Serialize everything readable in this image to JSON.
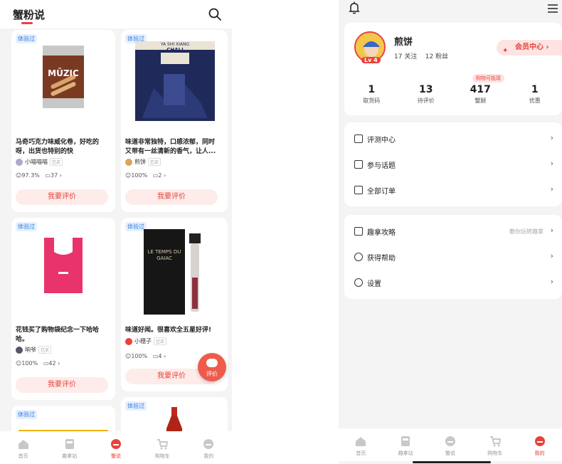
{
  "left": {
    "header": {
      "title": "蟹粉说"
    },
    "cards": [
      {
        "tag": "体验过",
        "brand": "MŪZIC",
        "title": "马奇巧克力味威化卷，好吃的呀，出货也特别的快",
        "user": "小喵喵喵",
        "user_chip": "已买",
        "rate": "97.3%",
        "comments": "37",
        "button": "我要评价"
      },
      {
        "tag": "体验过",
        "brand": "YA SHI XIANG",
        "brand_sub": "CHALI",
        "title": "味道非常独特，口感浓郁，同时又带有一丝清新的香气，让人...",
        "user": "煎饼",
        "user_chip": "已买",
        "rate": "100%",
        "comments": "2",
        "button": "我要评价"
      },
      {
        "tag": "体验过",
        "title": "花钱买了购物袋纪念一下哈哈哈。",
        "user": "晌爷",
        "user_chip": "已买",
        "rate": "100%",
        "comments": "42",
        "button": "我要评价"
      },
      {
        "tag": "体验过",
        "brand": "LE TEMPS DU GAIAC",
        "title": "味道好闻。很喜欢全五星好评!",
        "user": "小穗子",
        "user_chip": "已买",
        "rate": "100%",
        "comments": "4",
        "button": "我要评价"
      },
      {
        "tag": "体验过"
      },
      {
        "tag": "体验过"
      }
    ],
    "fab_label": "评价",
    "tabs": [
      "首页",
      "趣拿站",
      "蟹说",
      "购物车",
      "我的"
    ],
    "active_tab": 2
  },
  "right": {
    "profile": {
      "name": "煎饼",
      "level": "Lv 4",
      "follow": "17 关注",
      "fans": "12 粉丝",
      "member": "会员中心",
      "badge": "购物可抵现",
      "stats": [
        {
          "value": "1",
          "label": "取货码"
        },
        {
          "value": "13",
          "label": "待评价"
        },
        {
          "value": "417",
          "label": "蟹腿"
        },
        {
          "value": "1",
          "label": "优惠"
        }
      ]
    },
    "menu1": [
      {
        "label": "评测中心"
      },
      {
        "label": "参与话题"
      },
      {
        "label": "全部订单"
      }
    ],
    "menu2": [
      {
        "label": "趣拿攻略",
        "hint": "教你玩转趣拿"
      },
      {
        "label": "获得帮助"
      },
      {
        "label": "设置"
      }
    ],
    "tabs": [
      "首页",
      "趣拿站",
      "蟹说",
      "购物车",
      "我的"
    ],
    "active_tab": 4
  },
  "colors": {
    "accent": "#e8423a",
    "tag_blue": "#2f7de1",
    "background": "#f4f4f4"
  }
}
